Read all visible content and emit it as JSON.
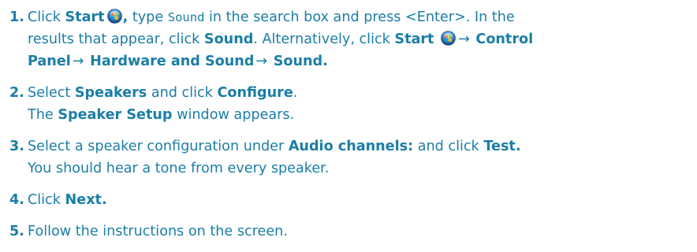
{
  "steps": [
    {
      "number": "1.",
      "click": "Click",
      "start": "Start",
      "after_start_icon": ",",
      "type": "type",
      "search_term": "Sound",
      "in_box": "in the search box and press <Enter>. In the",
      "results": "results that appear, click",
      "sound": "Sound",
      "alternatively": ". Alternatively, click",
      "start2": "Start",
      "arrow": "→",
      "control": "Control",
      "panel": "Panel",
      "hardware": "Hardware and Sound",
      "sound_end": "Sound."
    },
    {
      "number": "2.",
      "select": "Select",
      "speakers": "Speakers",
      "and_click": "and click",
      "configure": "Configure",
      "period": ".",
      "the": "The",
      "speaker_setup": "Speaker Setup",
      "window_appears": "window appears."
    },
    {
      "number": "3.",
      "select_config": "Select a speaker configuration under",
      "audio_channels": "Audio channels:",
      "and_click": "and click",
      "test": "Test.",
      "hear_tone": "You should hear a tone from every speaker."
    },
    {
      "number": "4.",
      "click": "Click",
      "next": "Next."
    },
    {
      "number": "5.",
      "follow": "Follow the instructions on the screen."
    }
  ],
  "icons": {
    "start_orb": "windows-start-orb-icon"
  },
  "colors": {
    "text": "#1b7ea6"
  }
}
